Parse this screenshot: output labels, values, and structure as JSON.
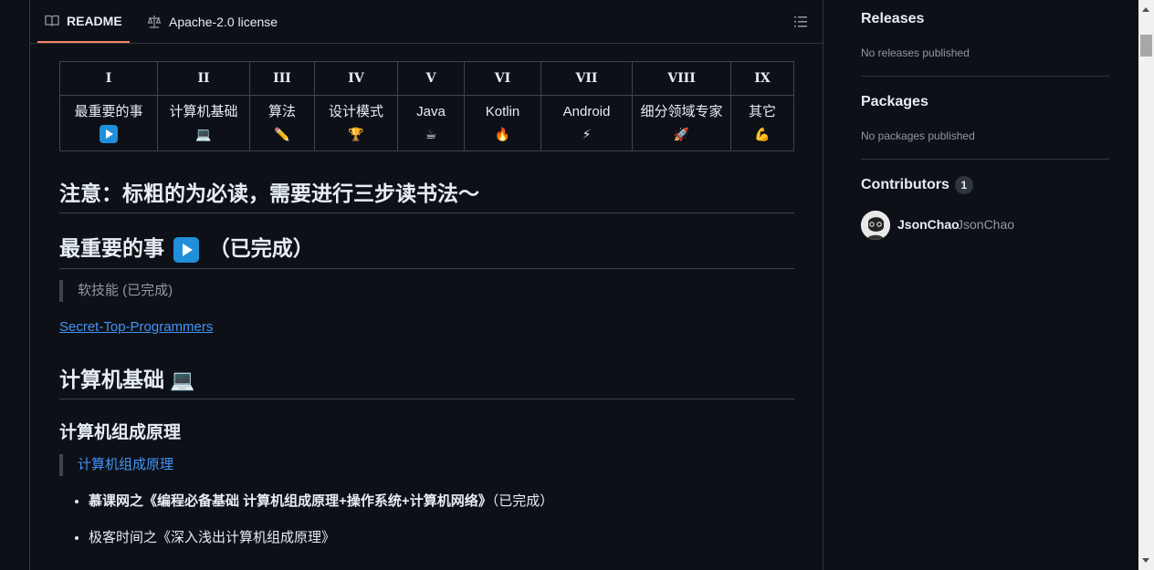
{
  "tabs": {
    "readme": "README",
    "license": "Apache-2.0 license"
  },
  "toc": {
    "headers": [
      "I",
      "II",
      "III",
      "IV",
      "V",
      "VI",
      "VII",
      "VIII",
      "IX"
    ],
    "cells": [
      {
        "text": "最重要的事",
        "emoji": "play-button-icon"
      },
      {
        "text": "计算机基础",
        "emoji": "laptop-icon"
      },
      {
        "text": "算法",
        "emoji": "pencil-icon"
      },
      {
        "text": "设计模式",
        "emoji": "trophy-icon"
      },
      {
        "text": "Java",
        "emoji": "coffee-icon"
      },
      {
        "text": "Kotlin",
        "emoji": "fire-icon"
      },
      {
        "text": "Android",
        "emoji": "lightning-icon"
      },
      {
        "text": "细分领域专家",
        "emoji": "rocket-icon"
      },
      {
        "text": "其它",
        "emoji": "muscle-icon"
      }
    ]
  },
  "content": {
    "note_heading": "注意：标粗的为必读，需要进行三步读书法～",
    "most_important_heading": "最重要的事",
    "most_important_suffix": "（已完成）",
    "soft_skill_quote": "软技能 (已完成)",
    "secret_link": "Secret-Top-Programmers",
    "cs_basics_heading": "计算机基础",
    "composition_heading": "计算机组成原理",
    "composition_link": "计算机组成原理",
    "list_items": [
      {
        "bold": "慕课网之《编程必备基础 计算机组成原理+操作系统+计算机网络》",
        "rest": "（已完成）"
      },
      {
        "bold": "",
        "rest": "极客时间之《深入浅出计算机组成原理》"
      }
    ]
  },
  "sidebar": {
    "releases_title": "Releases",
    "releases_empty": "No releases published",
    "packages_title": "Packages",
    "packages_empty": "No packages published",
    "contributors_title": "Contributors",
    "contributors_count": "1",
    "contributor_name": "JsonChao",
    "contributor_login": "JsonChao"
  },
  "colors": {
    "background": "#0d1117",
    "accent_tab": "#f78166",
    "link": "#4493f8",
    "border": "#30363d"
  }
}
